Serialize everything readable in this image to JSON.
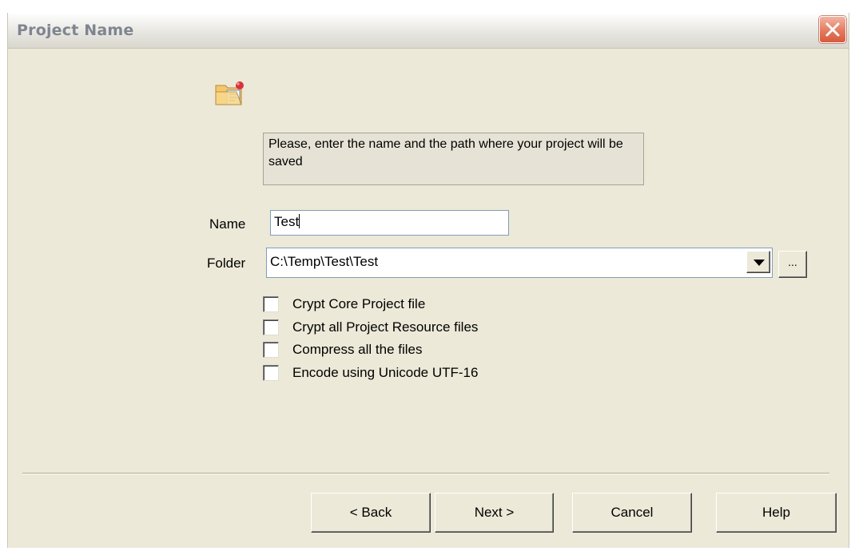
{
  "window": {
    "title": "Project Name"
  },
  "icons": {
    "project": "project-folder-icon",
    "close": "close-icon",
    "dropdown": "dropdown-arrow-icon"
  },
  "info_text": "Please, enter the name and the path where your project will be saved",
  "name_field": {
    "label": "Name",
    "value": "Test"
  },
  "folder_field": {
    "label": "Folder",
    "value": "C:\\Temp\\Test\\Test",
    "browse_label": "..."
  },
  "options": [
    {
      "label": "Crypt Core Project file",
      "checked": false
    },
    {
      "label": "Crypt all Project Resource files",
      "checked": false
    },
    {
      "label": "Compress all the files",
      "checked": false
    },
    {
      "label": "Encode using Unicode UTF-16",
      "checked": false
    }
  ],
  "buttons": {
    "back": "< Back",
    "next": "Next >",
    "cancel": "Cancel",
    "help": "Help"
  },
  "colors": {
    "dialog_bg": "#ece9d8",
    "close_button": "#e57a5d",
    "title_text": "#7f8590"
  }
}
